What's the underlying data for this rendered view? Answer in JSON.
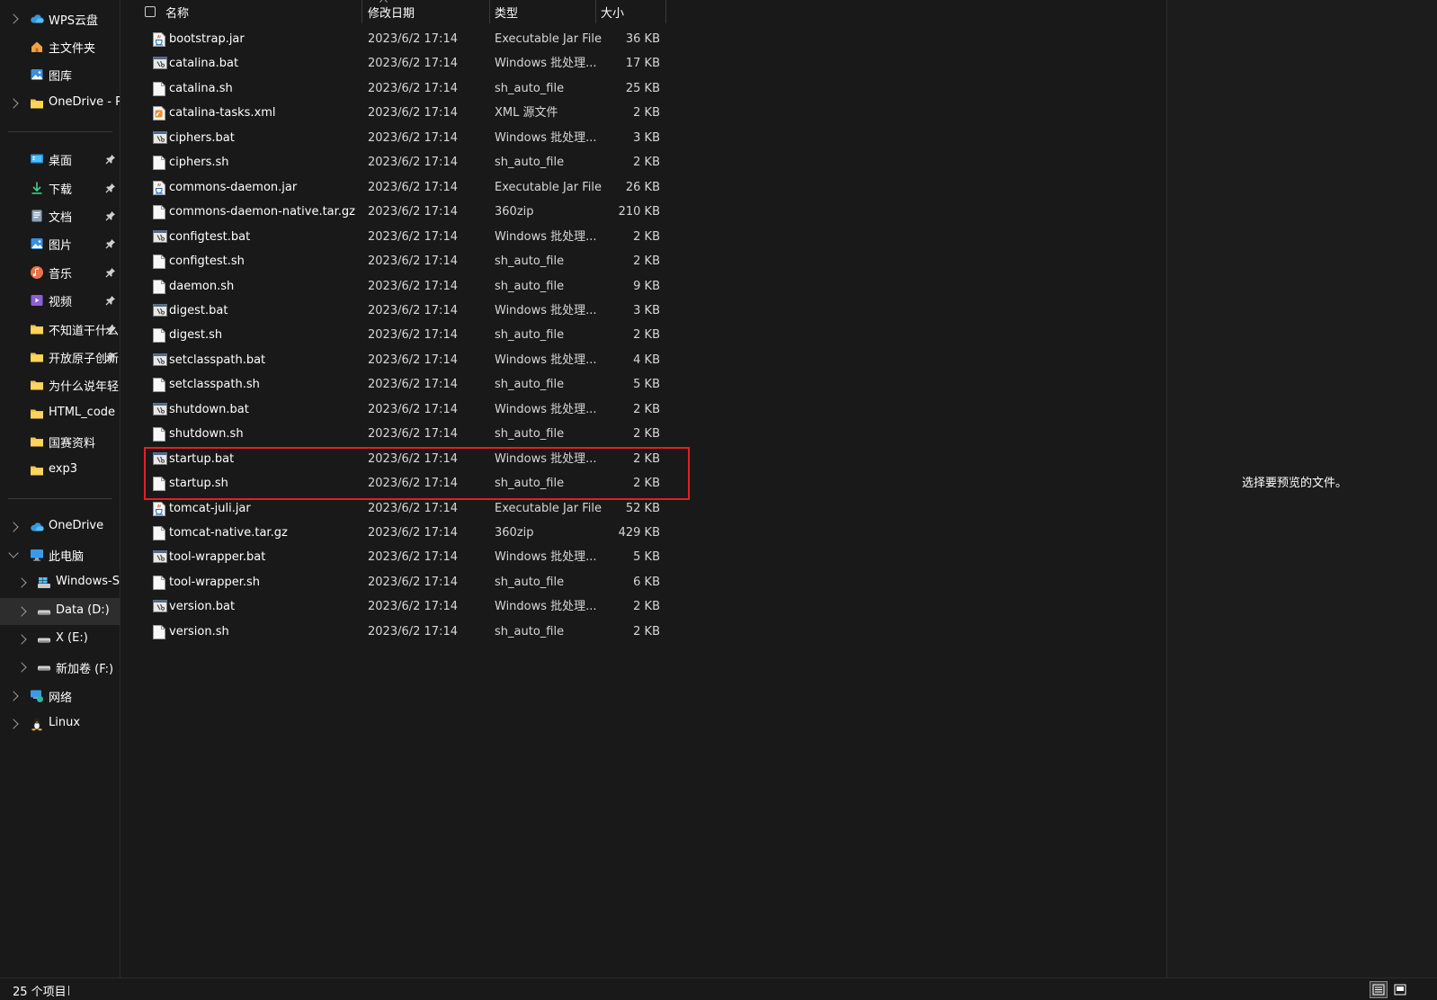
{
  "sidebar": {
    "items": [
      {
        "label": "WPS云盘",
        "icon": "wps-cloud-icon",
        "chevron": "right"
      },
      {
        "label": "主文件夹",
        "icon": "home-icon",
        "chevron": ""
      },
      {
        "label": "图库",
        "icon": "gallery-icon",
        "chevron": ""
      },
      {
        "label": "OneDrive - Pe",
        "icon": "folder-icon",
        "chevron": "right"
      },
      {
        "label": "桌面",
        "icon": "desktop-icon",
        "chevron": "",
        "pinned": true
      },
      {
        "label": "下载",
        "icon": "download-icon",
        "chevron": "",
        "pinned": true
      },
      {
        "label": "文档",
        "icon": "documents-icon",
        "chevron": "",
        "pinned": true
      },
      {
        "label": "图片",
        "icon": "pictures-icon",
        "chevron": "",
        "pinned": true
      },
      {
        "label": "音乐",
        "icon": "music-icon",
        "chevron": "",
        "pinned": true
      },
      {
        "label": "视频",
        "icon": "videos-icon",
        "chevron": "",
        "pinned": true
      },
      {
        "label": "不知道干什么",
        "icon": "folder-icon",
        "chevron": "",
        "pinned": true
      },
      {
        "label": "开放原子创新",
        "icon": "folder-icon",
        "chevron": "",
        "pinned": true
      },
      {
        "label": "为什么说年轻人",
        "icon": "folder-icon",
        "chevron": ""
      },
      {
        "label": "HTML_code",
        "icon": "folder-icon",
        "chevron": ""
      },
      {
        "label": "国赛资料",
        "icon": "folder-icon",
        "chevron": ""
      },
      {
        "label": "exp3",
        "icon": "folder-icon",
        "chevron": ""
      },
      {
        "label": "OneDrive",
        "icon": "onedrive-icon",
        "chevron": "right"
      },
      {
        "label": "此电脑",
        "icon": "this-pc-icon",
        "chevron": "down"
      },
      {
        "label": "Windows-SS",
        "icon": "windows-drive-icon",
        "chevron": "right"
      },
      {
        "label": "Data (D:)",
        "icon": "drive-icon",
        "chevron": "right",
        "selected": true
      },
      {
        "label": "X (E:)",
        "icon": "drive-icon",
        "chevron": "right"
      },
      {
        "label": "新加卷 (F:)",
        "icon": "drive-icon",
        "chevron": "right"
      },
      {
        "label": "网络",
        "icon": "network-icon",
        "chevron": "right"
      },
      {
        "label": "Linux",
        "icon": "linux-icon",
        "chevron": "right"
      }
    ]
  },
  "columns": {
    "name": "名称",
    "date": "修改日期",
    "type": "类型",
    "size": "大小"
  },
  "files": [
    {
      "name": "bootstrap.jar",
      "date": "2023/6/2 17:14",
      "type": "Executable Jar File",
      "size": "36 KB",
      "icon": "jar-file-icon"
    },
    {
      "name": "catalina.bat",
      "date": "2023/6/2 17:14",
      "type": "Windows 批处理...",
      "size": "17 KB",
      "icon": "bat-file-icon"
    },
    {
      "name": "catalina.sh",
      "date": "2023/6/2 17:14",
      "type": "sh_auto_file",
      "size": "25 KB",
      "icon": "blank-file-icon"
    },
    {
      "name": "catalina-tasks.xml",
      "date": "2023/6/2 17:14",
      "type": "XML 源文件",
      "size": "2 KB",
      "icon": "xml-file-icon"
    },
    {
      "name": "ciphers.bat",
      "date": "2023/6/2 17:14",
      "type": "Windows 批处理...",
      "size": "3 KB",
      "icon": "bat-file-icon"
    },
    {
      "name": "ciphers.sh",
      "date": "2023/6/2 17:14",
      "type": "sh_auto_file",
      "size": "2 KB",
      "icon": "blank-file-icon"
    },
    {
      "name": "commons-daemon.jar",
      "date": "2023/6/2 17:14",
      "type": "Executable Jar File",
      "size": "26 KB",
      "icon": "jar-file-icon"
    },
    {
      "name": "commons-daemon-native.tar.gz",
      "date": "2023/6/2 17:14",
      "type": "360zip",
      "size": "210 KB",
      "icon": "blank-file-icon"
    },
    {
      "name": "configtest.bat",
      "date": "2023/6/2 17:14",
      "type": "Windows 批处理...",
      "size": "2 KB",
      "icon": "bat-file-icon"
    },
    {
      "name": "configtest.sh",
      "date": "2023/6/2 17:14",
      "type": "sh_auto_file",
      "size": "2 KB",
      "icon": "blank-file-icon"
    },
    {
      "name": "daemon.sh",
      "date": "2023/6/2 17:14",
      "type": "sh_auto_file",
      "size": "9 KB",
      "icon": "blank-file-icon"
    },
    {
      "name": "digest.bat",
      "date": "2023/6/2 17:14",
      "type": "Windows 批处理...",
      "size": "3 KB",
      "icon": "bat-file-icon"
    },
    {
      "name": "digest.sh",
      "date": "2023/6/2 17:14",
      "type": "sh_auto_file",
      "size": "2 KB",
      "icon": "blank-file-icon"
    },
    {
      "name": "setclasspath.bat",
      "date": "2023/6/2 17:14",
      "type": "Windows 批处理...",
      "size": "4 KB",
      "icon": "bat-file-icon"
    },
    {
      "name": "setclasspath.sh",
      "date": "2023/6/2 17:14",
      "type": "sh_auto_file",
      "size": "5 KB",
      "icon": "blank-file-icon"
    },
    {
      "name": "shutdown.bat",
      "date": "2023/6/2 17:14",
      "type": "Windows 批处理...",
      "size": "2 KB",
      "icon": "bat-file-icon"
    },
    {
      "name": "shutdown.sh",
      "date": "2023/6/2 17:14",
      "type": "sh_auto_file",
      "size": "2 KB",
      "icon": "blank-file-icon"
    },
    {
      "name": "startup.bat",
      "date": "2023/6/2 17:14",
      "type": "Windows 批处理...",
      "size": "2 KB",
      "icon": "bat-file-icon"
    },
    {
      "name": "startup.sh",
      "date": "2023/6/2 17:14",
      "type": "sh_auto_file",
      "size": "2 KB",
      "icon": "blank-file-icon"
    },
    {
      "name": "tomcat-juli.jar",
      "date": "2023/6/2 17:14",
      "type": "Executable Jar File",
      "size": "52 KB",
      "icon": "jar-file-icon"
    },
    {
      "name": "tomcat-native.tar.gz",
      "date": "2023/6/2 17:14",
      "type": "360zip",
      "size": "429 KB",
      "icon": "blank-file-icon"
    },
    {
      "name": "tool-wrapper.bat",
      "date": "2023/6/2 17:14",
      "type": "Windows 批处理...",
      "size": "5 KB",
      "icon": "bat-file-icon"
    },
    {
      "name": "tool-wrapper.sh",
      "date": "2023/6/2 17:14",
      "type": "sh_auto_file",
      "size": "6 KB",
      "icon": "blank-file-icon"
    },
    {
      "name": "version.bat",
      "date": "2023/6/2 17:14",
      "type": "Windows 批处理...",
      "size": "2 KB",
      "icon": "bat-file-icon"
    },
    {
      "name": "version.sh",
      "date": "2023/6/2 17:14",
      "type": "sh_auto_file",
      "size": "2 KB",
      "icon": "blank-file-icon"
    }
  ],
  "highlight": {
    "color": "#e01f26",
    "rows": [
      "startup.bat",
      "startup.sh"
    ]
  },
  "preview": {
    "message": "选择要预览的文件。"
  },
  "status": {
    "item_count": "25 个项目"
  },
  "colors": {
    "background": "#191919",
    "selected": "#2d2d2d",
    "folder": "#f0c24b",
    "accent": "#4cc2ff"
  }
}
